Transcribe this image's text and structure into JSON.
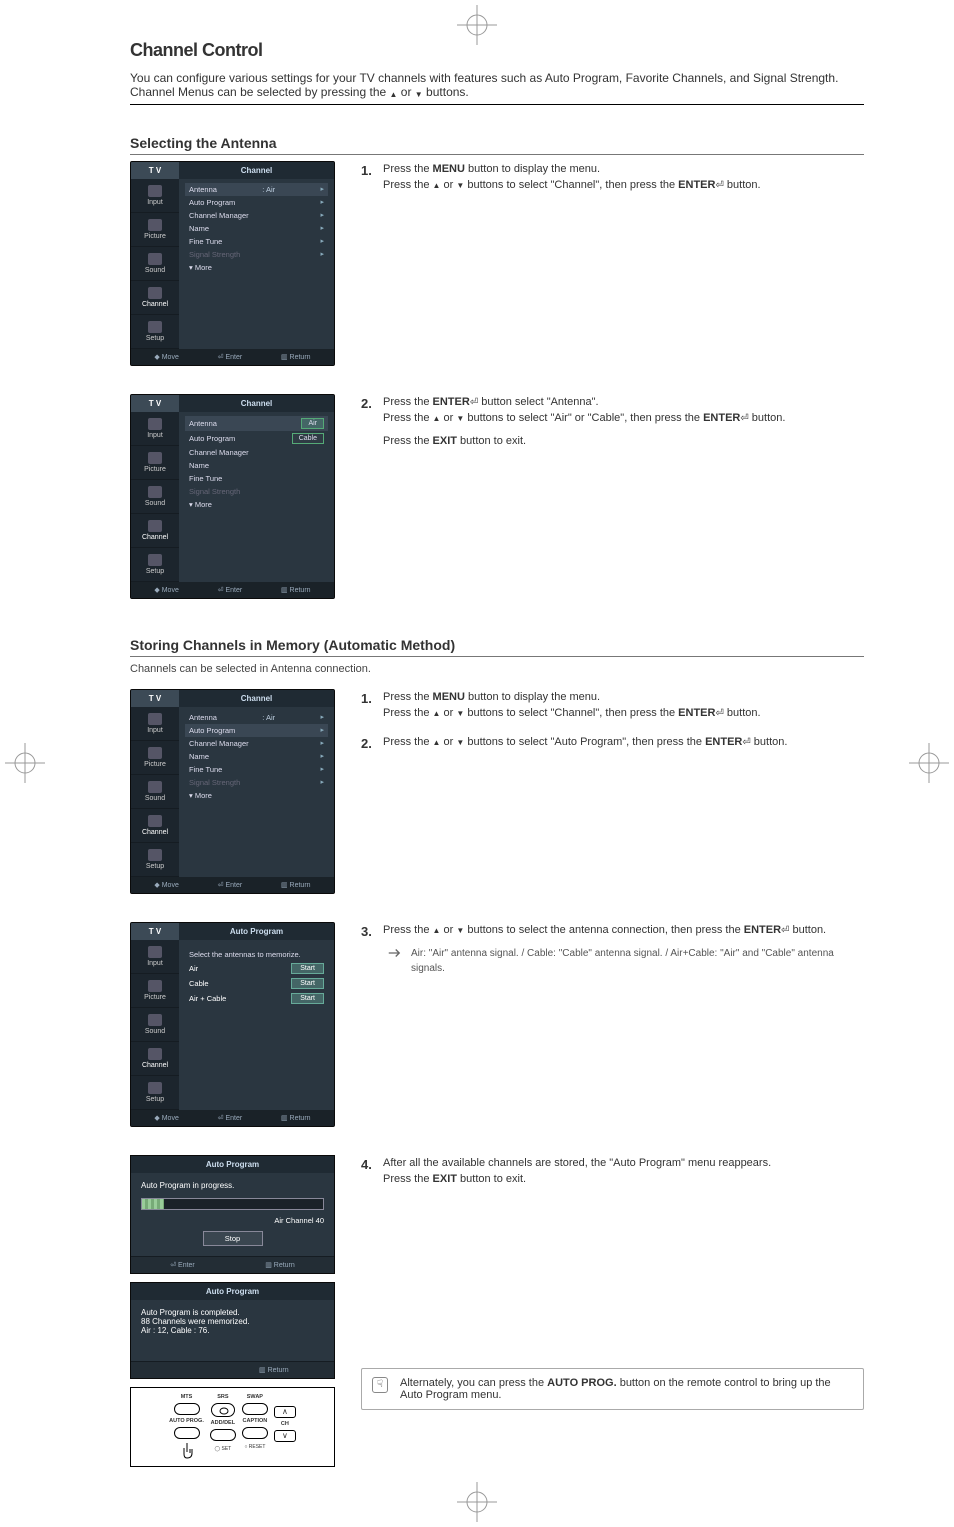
{
  "header": {
    "title": "Channel Control",
    "subtitle_prefix": "You can configure various settings for your TV channels with features such as Auto Program, Favorite Channels, and Signal Strength. Channel Menus can be selected by pressing the ",
    "subtitle_mid": " or ",
    "subtitle_suffix": " buttons."
  },
  "sections": {
    "antenna": {
      "title": "Selecting the Antenna",
      "steps": {
        "s1": {
          "num": "1.",
          "l1_a": "Press the ",
          "l1_b": "MENU",
          "l1_c": " button to display the menu.",
          "l2_a": "Press the ",
          "l2_b": " or ",
          "l2_c": " buttons to select \"Channel\", then press the ",
          "l2_d": "ENTER",
          "l2_e": " button."
        },
        "s2": {
          "num": "2.",
          "l1_a": "Press the ",
          "l1_b": "ENTER",
          "l1_c": " button select \"Antenna\".",
          "l2_a": "Press the ",
          "l2_b": " or ",
          "l2_c": " buttons to select \"Air\" or \"Cable\", then press the ",
          "l2_d": "ENTER",
          "l2_e": " button.",
          "l3_a": "Press the ",
          "l3_b": "EXIT",
          "l3_c": " button to exit."
        }
      }
    },
    "autoprog": {
      "title": "Storing Channels in Memory (Automatic Method)",
      "sub": "Channels can be selected in Antenna connection.",
      "steps": {
        "s1": {
          "num": "1.",
          "l1_a": "Press the ",
          "l1_b": "MENU",
          "l1_c": " button to display the menu.",
          "l2_a": "Press the ",
          "l2_b": " or ",
          "l2_c": " buttons to select \"Channel\", then press the ",
          "l2_d": "ENTER",
          "l2_e": " button."
        },
        "s2": {
          "num": "2.",
          "l1_a": "Press the ",
          "l1_b": " or ",
          "l1_c": " buttons to select \"Auto Program\", then press the ",
          "l1_d": "ENTER",
          "l1_e": " button."
        },
        "s3": {
          "num": "3.",
          "l1_a": "Press the ",
          "l1_b": " or ",
          "l1_c": " buttons to select the antenna connection, then press the ",
          "l1_d": "ENTER",
          "l1_e": " button.",
          "note": "Air: \"Air\" antenna signal. / Cable: \"Cable\" antenna signal. / Air+Cable: \"Air\" and \"Cable\" antenna signals."
        },
        "s4": {
          "num": "4.",
          "l1": "After all the available channels are stored, the \"Auto Program\" menu reappears.",
          "l2_a": "Press the ",
          "l2_b": "EXIT",
          "l2_c": " button to exit."
        }
      },
      "tip_a": "Alternately, you can press the ",
      "tip_b": "AUTO PROG.",
      "tip_c": " button on the remote control to bring up the Auto Program menu."
    }
  },
  "osd": {
    "tv": "T V",
    "channel_title": "Channel",
    "autoprog_title": "Auto Program",
    "side": {
      "input": "Input",
      "picture": "Picture",
      "sound": "Sound",
      "channel": "Channel",
      "setup": "Setup"
    },
    "rows": {
      "antenna": "Antenna",
      "antenna_val": ": Air",
      "autoprogram": "Auto Program",
      "chmgr": "Channel Manager",
      "name": "Name",
      "finetune": "Fine Tune",
      "signal": "Signal Strength",
      "more": "More"
    },
    "foot": {
      "move": "Move",
      "enter": "Enter",
      "return": "Return"
    },
    "drop": {
      "air": "Air",
      "cable": "Cable"
    },
    "select_prompt": "Select the antennas to memorize.",
    "start": "Start",
    "opts": {
      "air": "Air",
      "cable": "Cable",
      "both": "Air + Cable"
    },
    "prog": {
      "inprogress": "Auto Program in progress.",
      "airch": "Air Channel  40",
      "stop": "Stop",
      "completed": "Auto Program is completed.",
      "memorized": "88 Channels were memorized.",
      "breakdown": "Air : 12, Cable : 76."
    }
  },
  "remote": {
    "mts": "MTS",
    "srs": "SRS",
    "swap": "SWAP",
    "autoprog": "AUTO PROG.",
    "adddel": "ADD/DEL",
    "caption": "CAPTION",
    "ch": "CH",
    "set": "SET",
    "reset": "RESET"
  },
  "glyphs": {
    "up": "▲",
    "down": "▼",
    "enter": "⏎",
    "triangle": "▸",
    "foot_move": "◆ Move",
    "foot_enter": "⏎ Enter",
    "foot_return": "▥ Return"
  }
}
